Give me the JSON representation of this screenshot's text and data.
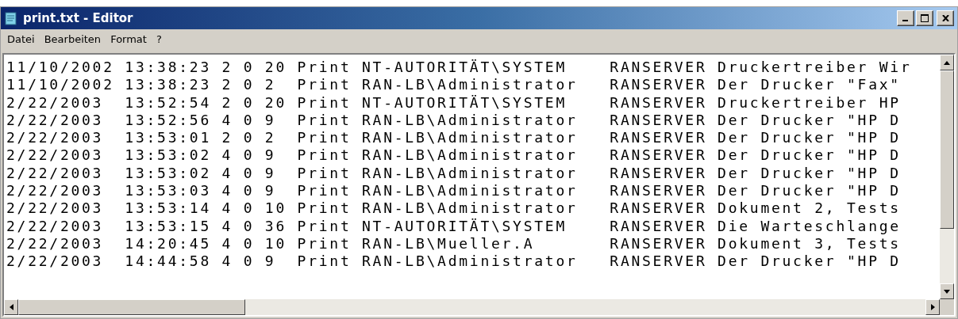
{
  "window": {
    "title": "print.txt - Editor"
  },
  "menu": [
    {
      "label": "Datei"
    },
    {
      "label": "Bearbeiten"
    },
    {
      "label": "Format"
    },
    {
      "label": "?"
    }
  ],
  "lines": [
    "11/10/2002 13:38:23 2 0 20 Print NT-AUTORITÄT\\SYSTEM    RANSERVER Druckertreiber Wir",
    "11/10/2002 13:38:23 2 0 2  Print RAN-LB\\Administrator   RANSERVER Der Drucker \"Fax\"",
    "2/22/2003  13:52:54 2 0 20 Print NT-AUTORITÄT\\SYSTEM    RANSERVER Druckertreiber HP",
    "2/22/2003  13:52:56 4 0 9  Print RAN-LB\\Administrator   RANSERVER Der Drucker \"HP D",
    "2/22/2003  13:53:01 2 0 2  Print RAN-LB\\Administrator   RANSERVER Der Drucker \"HP D",
    "2/22/2003  13:53:02 4 0 9  Print RAN-LB\\Administrator   RANSERVER Der Drucker \"HP D",
    "2/22/2003  13:53:02 4 0 9  Print RAN-LB\\Administrator   RANSERVER Der Drucker \"HP D",
    "2/22/2003  13:53:03 4 0 9  Print RAN-LB\\Administrator   RANSERVER Der Drucker \"HP D",
    "2/22/2003  13:53:14 4 0 10 Print RAN-LB\\Administrator   RANSERVER Dokument 2, Tests",
    "2/22/2003  13:53:15 4 0 36 Print NT-AUTORITÄT\\SYSTEM    RANSERVER Die Warteschlange",
    "2/22/2003  14:20:45 4 0 10 Print RAN-LB\\Mueller.A       RANSERVER Dokument 3, Tests",
    "2/22/2003  14:44:58 4 0 9  Print RAN-LB\\Administrator   RANSERVER Der Drucker \"HP D"
  ]
}
